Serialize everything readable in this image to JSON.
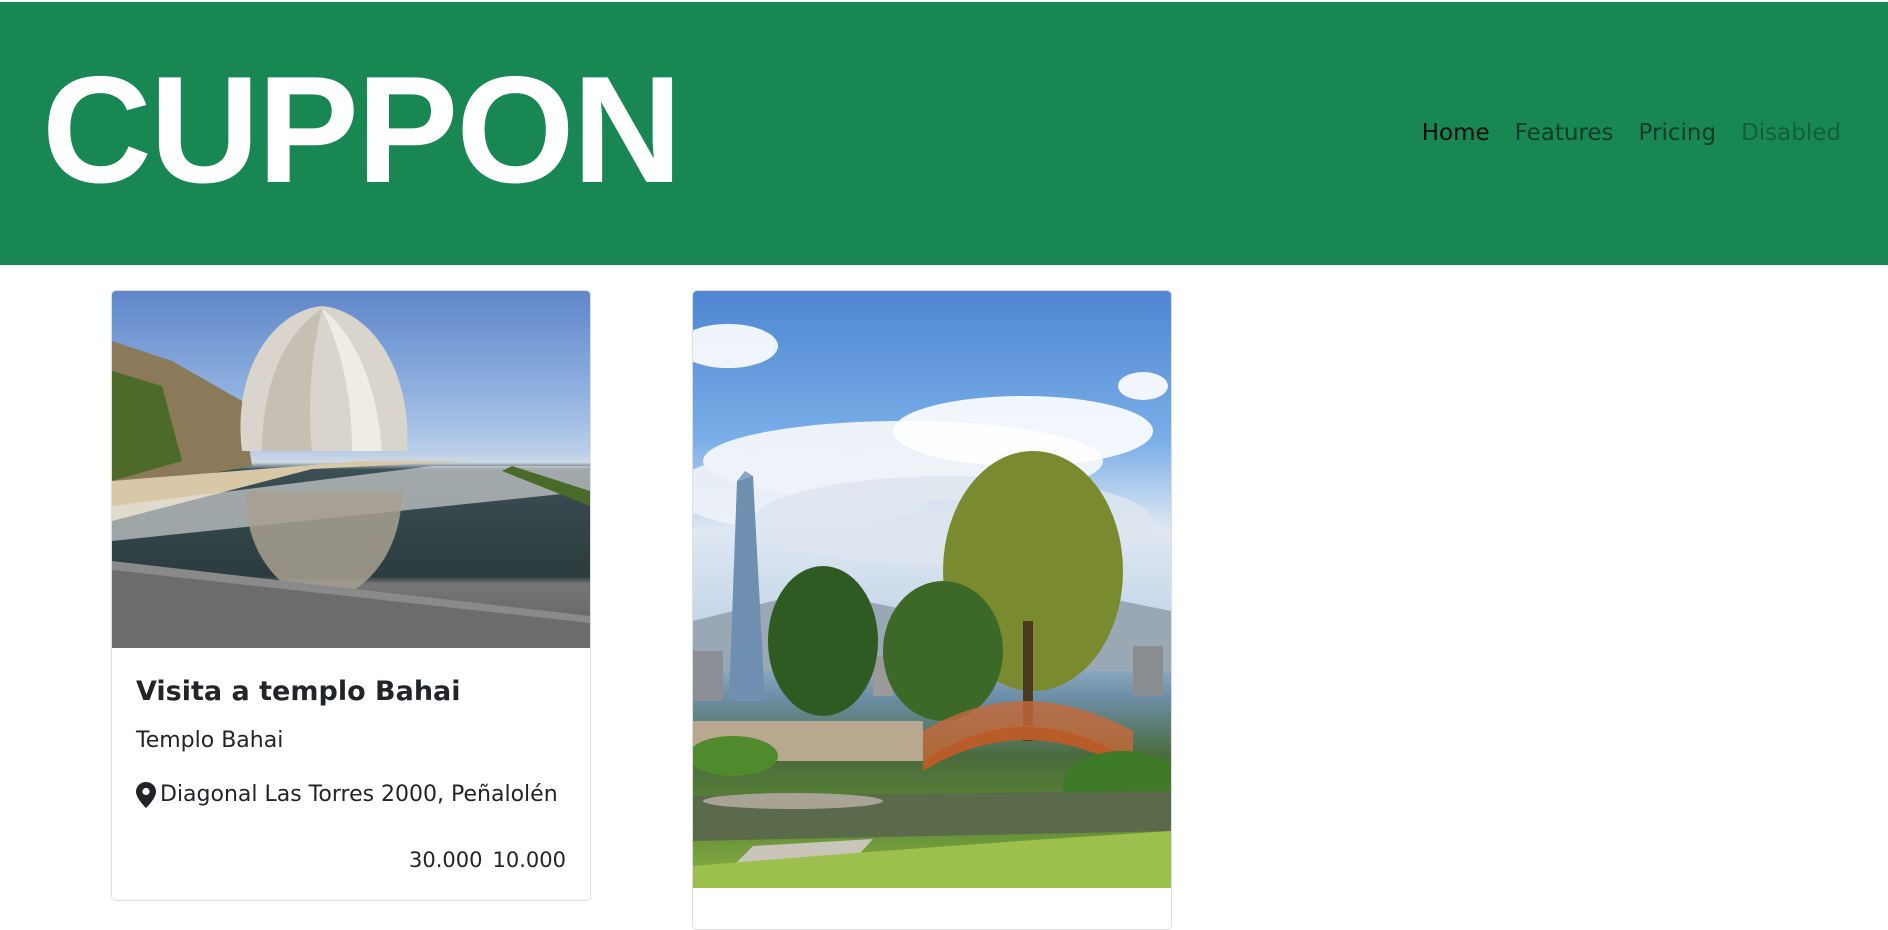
{
  "header": {
    "logo": "CUPPON",
    "nav": [
      {
        "label": "Home",
        "state": "active"
      },
      {
        "label": "Features",
        "state": "normal"
      },
      {
        "label": "Pricing",
        "state": "normal"
      },
      {
        "label": "Disabled",
        "state": "disabled"
      }
    ]
  },
  "colors": {
    "header_bg": "#198754",
    "logo": "#ffffff"
  },
  "cards": [
    {
      "image": "temple-photo",
      "title": "Visita a templo Bahai",
      "subtitle": "Templo Bahai",
      "location_icon": "map-pin-icon",
      "address": "Diagonal Las Torres 2000, Peñalolén",
      "price_original": "30.000",
      "price_discount": "10.000"
    },
    {
      "image": "japanese-garden-photo"
    }
  ]
}
